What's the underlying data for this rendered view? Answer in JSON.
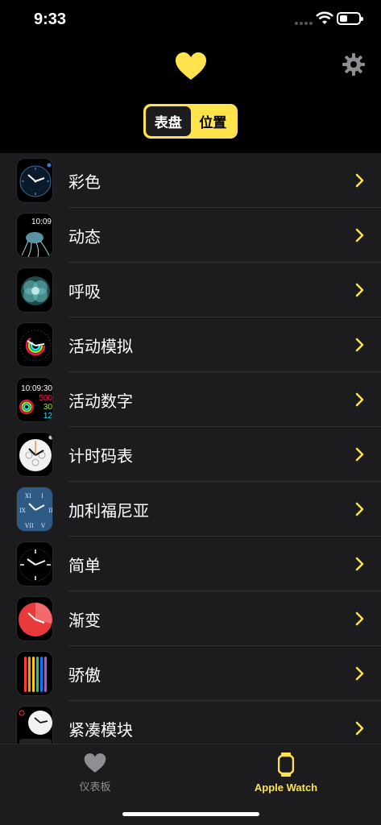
{
  "status": {
    "time": "9:33"
  },
  "header": {
    "segments": [
      {
        "label": "表盘",
        "active": true
      },
      {
        "label": "位置",
        "active": false
      }
    ]
  },
  "faces": [
    {
      "label": "彩色",
      "icon": "color-face-icon"
    },
    {
      "label": "动态",
      "icon": "motion-face-icon",
      "time": "10:09"
    },
    {
      "label": "呼吸",
      "icon": "breathe-face-icon"
    },
    {
      "label": "活动模拟",
      "icon": "activity-analog-face-icon"
    },
    {
      "label": "活动数字",
      "icon": "activity-digital-face-icon",
      "time": "10:09:30",
      "move": "500",
      "exercise": "30",
      "stand": "12"
    },
    {
      "label": "计时码表",
      "icon": "chronograph-face-icon"
    },
    {
      "label": "加利福尼亚",
      "icon": "california-face-icon"
    },
    {
      "label": "简单",
      "icon": "simple-face-icon"
    },
    {
      "label": "渐变",
      "icon": "gradient-face-icon"
    },
    {
      "label": "骄傲",
      "icon": "pride-face-icon"
    },
    {
      "label": "紧凑模块",
      "icon": "modular-compact-face-icon"
    }
  ],
  "tabbar": {
    "dashboard_label": "仪表板",
    "watch_label": "Apple Watch"
  },
  "colors": {
    "accent": "#ffe34d",
    "background": "#000000",
    "list_bg": "#1c1c1e"
  }
}
